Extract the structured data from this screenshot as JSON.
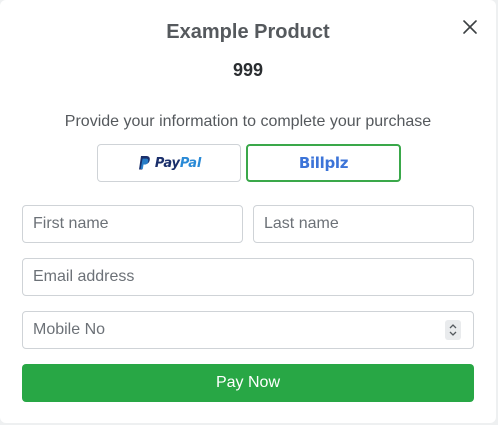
{
  "product": {
    "title": "Example Product",
    "price": "999"
  },
  "info_text": "Provide your information to complete your purchase",
  "payment_options": {
    "paypal": {
      "label_part1": "Pay",
      "label_part2": "Pal"
    },
    "billplz": {
      "label": "Billplz"
    }
  },
  "form": {
    "first_name_placeholder": "First name",
    "last_name_placeholder": "Last name",
    "email_placeholder": "Email address",
    "mobile_placeholder": "Mobile No"
  },
  "submit_label": "Pay Now",
  "icons": {
    "close": "close-icon",
    "paypal": "paypal-logo-icon",
    "stepper": "number-stepper-icon"
  },
  "colors": {
    "accent_green": "#28a745",
    "selected_border": "#3aa84a",
    "paypal_dark": "#1a2f6b",
    "paypal_light": "#2a8ad6",
    "billplz_blue": "#3c74d8"
  }
}
